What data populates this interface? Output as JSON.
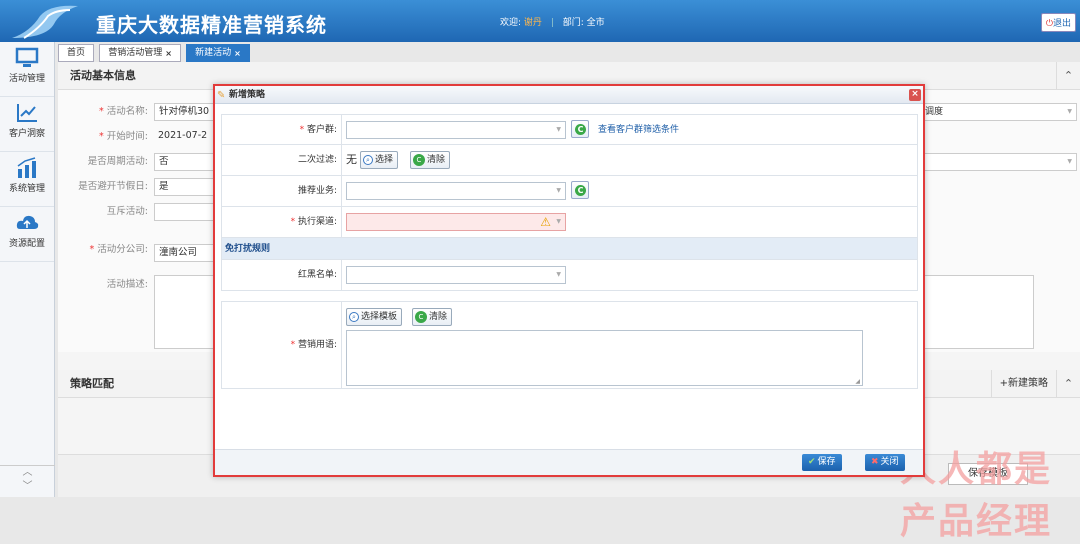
{
  "header": {
    "title": "重庆大数据精准营销系统",
    "welcome_label": "欢迎:",
    "user": "谢丹",
    "dept_label": "部门:",
    "dept": "全市",
    "logout": "退出"
  },
  "sidebar": [
    {
      "label": "活动管理",
      "icon": "monitor-icon"
    },
    {
      "label": "客户洞察",
      "icon": "chart-icon"
    },
    {
      "label": "系统管理",
      "icon": "bars-icon"
    },
    {
      "label": "资源配置",
      "icon": "cloud-icon"
    }
  ],
  "tabs": [
    {
      "label": "首页",
      "closable": false
    },
    {
      "label": "营销活动管理",
      "closable": true
    },
    {
      "label": "新建活动",
      "closable": true,
      "active": true
    }
  ],
  "tab_close": "×",
  "basic": {
    "title": "活动基本信息",
    "collapse": "⌃",
    "fields": [
      {
        "label": "活动名称:",
        "value": "针对停机30",
        "required": true
      },
      {
        "label": "开始时间:",
        "value": "2021-07-2",
        "required": true
      },
      {
        "label": "是否周期活动:",
        "value": "否",
        "required": false
      },
      {
        "label": "是否避开节假日:",
        "value": "是",
        "required": false
      },
      {
        "label": "互斥活动:",
        "value": "",
        "required": false
      },
      {
        "label": "活动分公司:",
        "value": "潼南公司",
        "required": true
      },
      {
        "label": "活动描述:",
        "value": "",
        "required": false
      }
    ],
    "right_select": "调度"
  },
  "strategy": {
    "title": "策略匹配",
    "new_button": "+新建策略",
    "collapse": "⌃"
  },
  "bottom": {
    "save_template": "保存模板"
  },
  "watermark": "人人都是产品经理",
  "dialog": {
    "title": "新增策略",
    "close": "×",
    "rows": {
      "customer_group": {
        "label": "客户群:",
        "required": true,
        "link": "查看客户群筛选条件"
      },
      "secondary_filter": {
        "label": "二次过滤:",
        "value": "无",
        "select_btn": "选择",
        "clear_btn": "清除"
      },
      "recommend": {
        "label": "推荐业务:"
      },
      "channel": {
        "label": "执行渠道:",
        "required": true
      },
      "section": "免打扰规则",
      "redlist": {
        "label": "红黑名单:"
      },
      "wording": {
        "label": "营销用语:",
        "required": true,
        "template_btn": "选择模板",
        "clear_btn": "清除"
      }
    },
    "footer": {
      "save": "保存",
      "close": "关闭"
    }
  },
  "colors": {
    "header": "#1f67b3",
    "dialog_border": "#e23b3b",
    "accent": "#2a78c6"
  }
}
